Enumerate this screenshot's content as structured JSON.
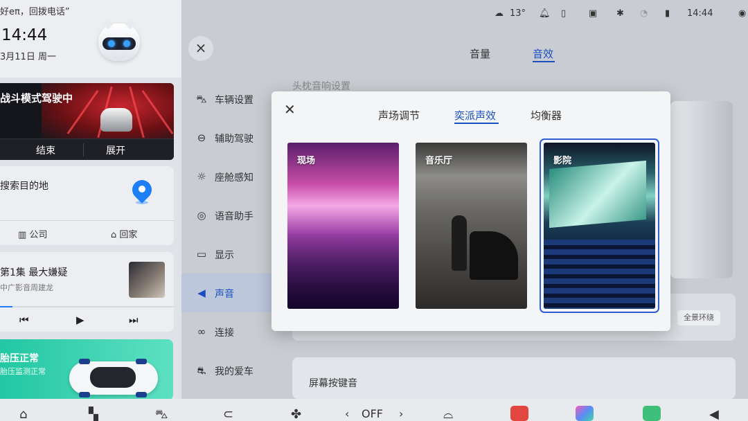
{
  "left_panel": {
    "greeting": "好eπ，回拨电话”",
    "time": "14:44",
    "date": "3月11日 周一",
    "battle": {
      "title": "战斗模式驾驶中",
      "end_label": "结束",
      "expand_label": "展开"
    },
    "nav": {
      "prompt": "搜索目的地",
      "company_label": "公司",
      "home_label": "回家"
    },
    "music": {
      "title": "第1集 最大嫌疑",
      "artist": "中广影音周建龙",
      "progress": 0.07
    },
    "tire": {
      "title": "胎压正常",
      "subtitle": "胎压监测正常"
    }
  },
  "status_bar": {
    "temperature": "13°",
    "time": "14:44"
  },
  "top_tabs": [
    {
      "label": "音量",
      "active": false
    },
    {
      "label": "音效",
      "active": true
    }
  ],
  "menu": [
    {
      "label": "车辆设置",
      "icon": "car-settings-icon",
      "active": false
    },
    {
      "label": "辅助驾驶",
      "icon": "steering-wheel-icon",
      "active": false
    },
    {
      "label": "座舱感知",
      "icon": "sun-icon",
      "active": false
    },
    {
      "label": "语音助手",
      "icon": "voice-icon",
      "active": false
    },
    {
      "label": "显示",
      "icon": "monitor-icon",
      "active": false
    },
    {
      "label": "声音",
      "icon": "speaker-icon",
      "active": true
    },
    {
      "label": "连接",
      "icon": "link-icon",
      "active": false
    },
    {
      "label": "我的爱车",
      "icon": "car-icon",
      "active": false
    }
  ],
  "content": {
    "headrest_label": "头枕音响设置",
    "surround_chip": "全景环绕",
    "screen_key_label": "屏幕按键音"
  },
  "modal": {
    "tabs": [
      {
        "label": "声场调节",
        "active": false
      },
      {
        "label": "奕派声效",
        "active": true
      },
      {
        "label": "均衡器",
        "active": false
      }
    ],
    "modes": [
      {
        "label": "现场",
        "selected": false
      },
      {
        "label": "音乐厅",
        "selected": false
      },
      {
        "label": "影院",
        "selected": true
      }
    ]
  },
  "dock": {
    "fan_status": "OFF"
  },
  "colors": {
    "accent": "#1a4fbf",
    "tire_green": "#22c7a3",
    "selection": "#2f5bd4"
  }
}
